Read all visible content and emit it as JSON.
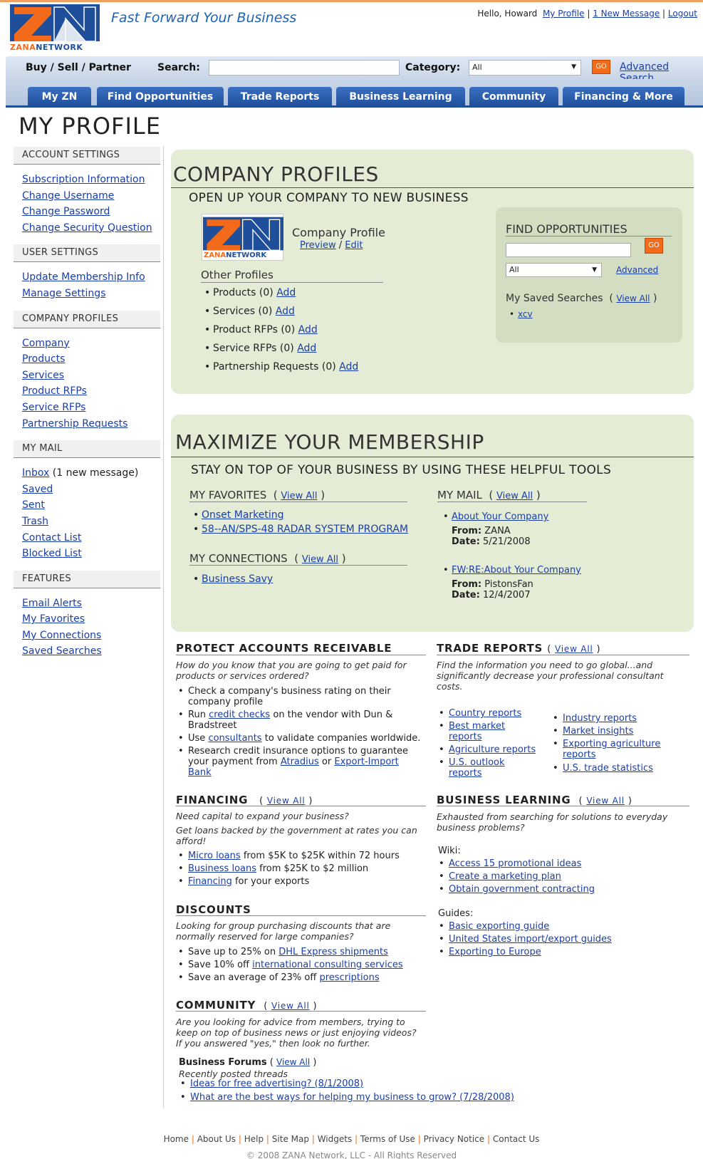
{
  "header": {
    "brand": "ZANANETWORK",
    "tagline": "Fast Forward Your Business",
    "greeting": "Hello, Howard",
    "links": [
      "My Profile",
      "1 New Message",
      "Logout"
    ]
  },
  "searchbar": {
    "buy_label": "Buy / Sell / Partner",
    "search_label": "Search:",
    "search_value": "",
    "category_label": "Category:",
    "category_value": "All",
    "go": "GO",
    "advanced": "Advanced Search"
  },
  "nav": [
    "My ZN",
    "Find Opportunities",
    "Trade Reports",
    "Business Learning",
    "Community",
    "Financing & More"
  ],
  "page_title": "MY PROFILE",
  "sidebar": {
    "account_settings": {
      "title": "ACCOUNT SETTINGS",
      "items": [
        "Subscription Information",
        "Change Username",
        "Change Password",
        "Change Security Question"
      ]
    },
    "user_settings": {
      "title": "USER SETTINGS",
      "items": [
        "Update Membership Info",
        "Manage Settings"
      ]
    },
    "company_profiles": {
      "title": "COMPANY PROFILES",
      "items": [
        "Company",
        "Products",
        "Services",
        "Product RFPs",
        "Service RFPs",
        "Partnership Requests"
      ]
    },
    "my_mail": {
      "title": "MY MAIL",
      "inbox": "Inbox",
      "inbox_note": "(1 new message)",
      "items": [
        "Saved",
        "Sent",
        "Trash",
        "Contact List",
        "Blocked List"
      ]
    },
    "features": {
      "title": "FEATURES",
      "items": [
        "Email Alerts",
        "My Favorites",
        "My Connections",
        "Saved Searches"
      ]
    }
  },
  "company_profiles": {
    "title": "COMPANY PROFILES",
    "subtitle": "OPEN UP YOUR COMPANY TO NEW BUSINESS",
    "profile_label": "Company Profile",
    "preview": "Preview",
    "sep": "/",
    "edit": "Edit",
    "other_profiles": "Other Profiles",
    "add": "Add",
    "items": [
      "Products (0)",
      "Services (0)",
      "Product RFPs (0)",
      "Service RFPs (0)",
      "Partnership Requests (0)"
    ]
  },
  "find_opportunities": {
    "title": "FIND OPPORTUNITIES",
    "input_value": "",
    "go": "GO",
    "select_value": "All",
    "advanced": "Advanced",
    "saved_searches": "My Saved Searches",
    "view_all": "View All",
    "saved": [
      "xcv"
    ]
  },
  "membership": {
    "title": "MAXIMIZE YOUR MEMBERSHIP",
    "subtitle": "STAY ON TOP OF YOUR BUSINESS BY USING THESE HELPFUL TOOLS",
    "favorites_title": "MY FAVORITES",
    "view_all": "View All",
    "favorites": [
      "Onset Marketing",
      "58--AN/SPS-48 RADAR SYSTEM PROGRAM"
    ],
    "connections_title": "MY CONNECTIONS",
    "connections": [
      "Business Savy"
    ],
    "mail_title": "MY MAIL",
    "from_label": "From:",
    "date_label": "Date:",
    "mail": [
      {
        "subject": "About Your Company",
        "from": "ZANA",
        "date": "5/21/2008"
      },
      {
        "subject": "FW:RE:About Your Company",
        "from": "PistonsFan",
        "date": "12/4/2007"
      }
    ]
  },
  "protect": {
    "title": "PROTECT ACCOUNTS RECEIVABLE",
    "intro": "How do you know that you are going to get paid for products or services ordered?",
    "b1": "Check a company's business rating on their company profile",
    "b2a": "Run",
    "b2link": "credit checks",
    "b2b": "on the vendor with Dun & Bradstreet",
    "b3a": "Use",
    "b3link": "consultants",
    "b3b": "to validate companies worldwide.",
    "b4a": "Research credit insurance options to guarantee your payment from",
    "b4link1": "Atradius",
    "b4or": "or",
    "b4link2": "Export-Import Bank"
  },
  "trade_reports": {
    "title": "TRADE REPORTS",
    "view_all": "View All",
    "intro": "Find the information you need to go global...and significantly decrease your professional consultant costs.",
    "left": [
      "Country reports",
      "Best market reports",
      "Agriculture reports",
      "U.S. outlook reports"
    ],
    "right": [
      "Industry reports",
      "Market insights",
      "Exporting agriculture reports",
      "U.S. trade statistics"
    ]
  },
  "financing": {
    "title": "FINANCING",
    "view_all": "View All",
    "intro1": "Need capital to expand your business?",
    "intro2": "Get loans backed by the government at rates you can afford!",
    "items": [
      {
        "link": "Micro loans",
        "text": "from $5K to $25K within 72 hours"
      },
      {
        "link": "Business loans",
        "text": "from $25K to $2 million"
      },
      {
        "link": "Financing",
        "text": "for your exports"
      }
    ]
  },
  "business_learning": {
    "title": "BUSINESS LEARNING",
    "view_all": "View All",
    "intro": "Exhausted from searching for solutions to everyday business problems?",
    "wiki_label": "Wiki:",
    "wiki": [
      "Access 15 promotional ideas",
      "Create a marketing plan",
      "Obtain government contracting"
    ],
    "guides_label": "Guides:",
    "guides": [
      "Basic exporting guide",
      "United States import/export guides",
      "Exporting to Europe"
    ]
  },
  "discounts": {
    "title": "DISCOUNTS",
    "intro": "Looking for group purchasing discounts that are normally reserved for large companies?",
    "items": [
      {
        "text": "Save up to 25% on",
        "link": "DHL Express shipments"
      },
      {
        "text": "Save 10% off",
        "link": "international consulting services"
      },
      {
        "text": "Save an average of 23% off",
        "link": "prescriptions"
      }
    ]
  },
  "community": {
    "title": "COMMUNITY",
    "view_all": "View All",
    "intro": "Are you looking for advice from members, trying to keep on top of business news or just enjoying videos? If you answered \"yes,\" then look no further.",
    "forums_label": "Business Forums",
    "recent": "Recently posted threads",
    "threads": [
      "Ideas for free advertising? (8/1/2008)",
      "What are the best ways for helping my business to grow? (7/28/2008)"
    ]
  },
  "footer": {
    "links": [
      "Home",
      "About Us",
      "Help",
      "Site Map",
      "Widgets",
      "Terms of Use",
      "Privacy Notice",
      "Contact Us"
    ],
    "copyright": "© 2008 ZANA Network, LLC - All Rights Reserved"
  },
  "colors": {
    "brand_orange": "#f26a1a",
    "brand_blue": "#1f4f9a",
    "panel_green": "#e4ecd6",
    "link": "#1a3ea8"
  }
}
